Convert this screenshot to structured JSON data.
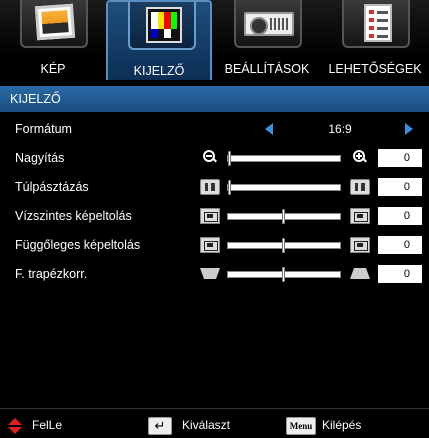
{
  "tabs": [
    {
      "label": "KÉP",
      "icon": "picture-icon",
      "active": false
    },
    {
      "label": "KIJELZŐ",
      "icon": "display-icon",
      "active": true
    },
    {
      "label": "BEÁLLÍTÁSOK",
      "icon": "projector-icon",
      "active": false
    },
    {
      "label": "LEHETŐSÉGEK",
      "icon": "options-list-icon",
      "active": false
    }
  ],
  "section_title": "KIJELZŐ",
  "rows": {
    "format": {
      "label": "Formátum",
      "value": "16:9"
    },
    "zoom": {
      "label": "Nagyítás",
      "value": "0",
      "level": 0.0
    },
    "overscan": {
      "label": "Túlpásztázás",
      "value": "0",
      "level": 0.0
    },
    "h_position": {
      "label": "Vízszintes képeltolás",
      "value": "0",
      "level": 0.5
    },
    "v_position": {
      "label": "Függőleges képeltolás",
      "value": "0",
      "level": 0.5
    },
    "keystone": {
      "label": "F. trapézkorr.",
      "value": "0",
      "level": 0.5
    }
  },
  "footer": {
    "navigate": "FelLe",
    "select": "Kiválaszt",
    "exit": "Kilépés",
    "enter_key": "↵",
    "menu_key": "Menu"
  },
  "colors": {
    "accent": "#2a6aa6",
    "arrow": "#3c8fe0",
    "nav_arrow": "#e02020"
  }
}
